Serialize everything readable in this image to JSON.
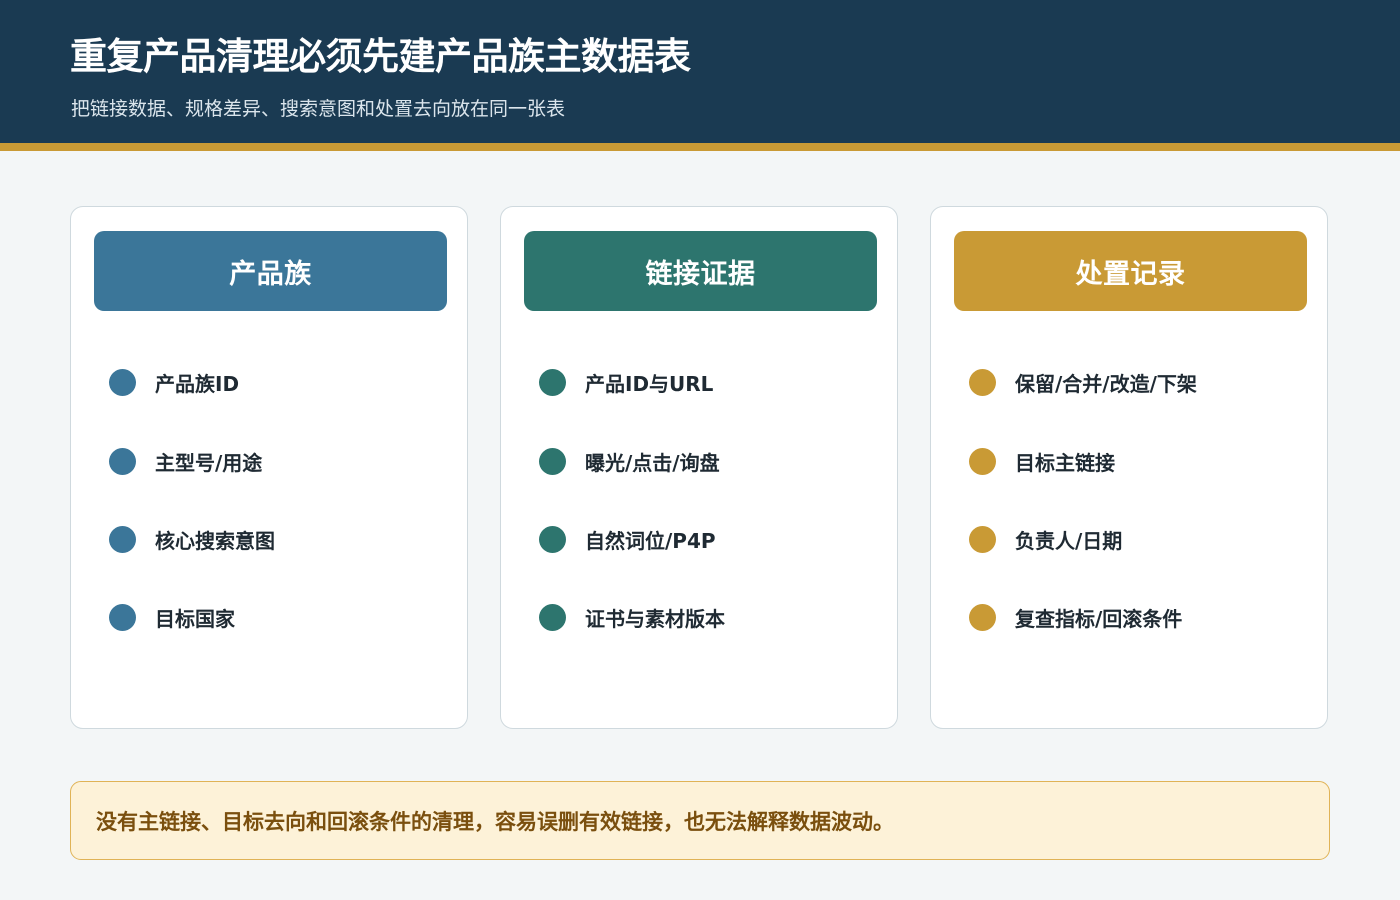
{
  "header": {
    "title": "重复产品清理必须先建产品族主数据表",
    "subtitle": "把链接数据、规格差异、搜索意图和处置去向放在同一张表"
  },
  "colors": {
    "header_bg": "#1a3a52",
    "accent_gold": "#c99a35",
    "family_blue": "#3b7699",
    "evidence_teal": "#2d756e",
    "record_gold": "#c99a35"
  },
  "cards": [
    {
      "title": "产品族",
      "color": "#3b7699",
      "items": [
        "产品族ID",
        "主型号/用途",
        "核心搜索意图",
        "目标国家"
      ]
    },
    {
      "title": "链接证据",
      "color": "#2d756e",
      "items": [
        "产品ID与URL",
        "曝光/点击/询盘",
        "自然词位/P4P",
        "证书与素材版本"
      ]
    },
    {
      "title": "处置记录",
      "color": "#c99a35",
      "items": [
        "保留/合并/改造/下架",
        "目标主链接",
        "负责人/日期",
        "复查指标/回滚条件"
      ]
    }
  ],
  "note": {
    "text": "没有主链接、目标去向和回滚条件的清理，容易误删有效链接，也无法解释数据波动。"
  }
}
